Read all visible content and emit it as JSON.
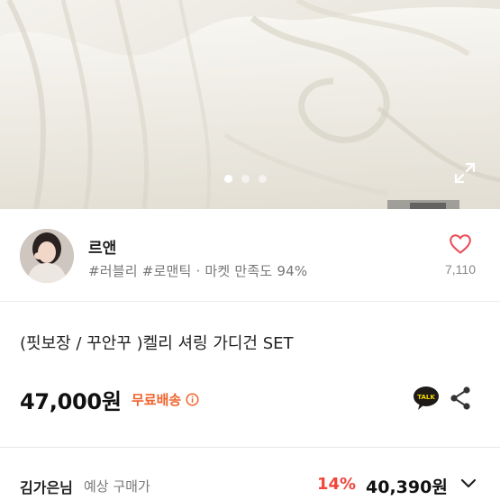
{
  "gallery": {
    "dots": [
      true,
      false,
      false
    ],
    "expand_icon": "expand-icon"
  },
  "seller": {
    "name": "르앤",
    "tags": "#러블리 #로맨틱 · 마켓 만족도 94%",
    "like_count": "7,110",
    "like_icon": "heart-outline-icon"
  },
  "product": {
    "title": "(핏보장 / 꾸안꾸 )켈리 셔링 가디건 SET",
    "price": "47,000원",
    "shipping": "무료배송",
    "shipping_info_icon": "info-icon",
    "talk_label": "TALK",
    "share_icon": "share-icon"
  },
  "expected_price": {
    "buyer": "김가은님",
    "label": "예상 구매가",
    "discount": "14%",
    "price": "40,390원",
    "toggle_icon": "chevron-down-icon"
  },
  "colors": {
    "accent_orange": "#f0632c",
    "discount_red": "#f0463c",
    "heart_red": "#e74a53"
  }
}
